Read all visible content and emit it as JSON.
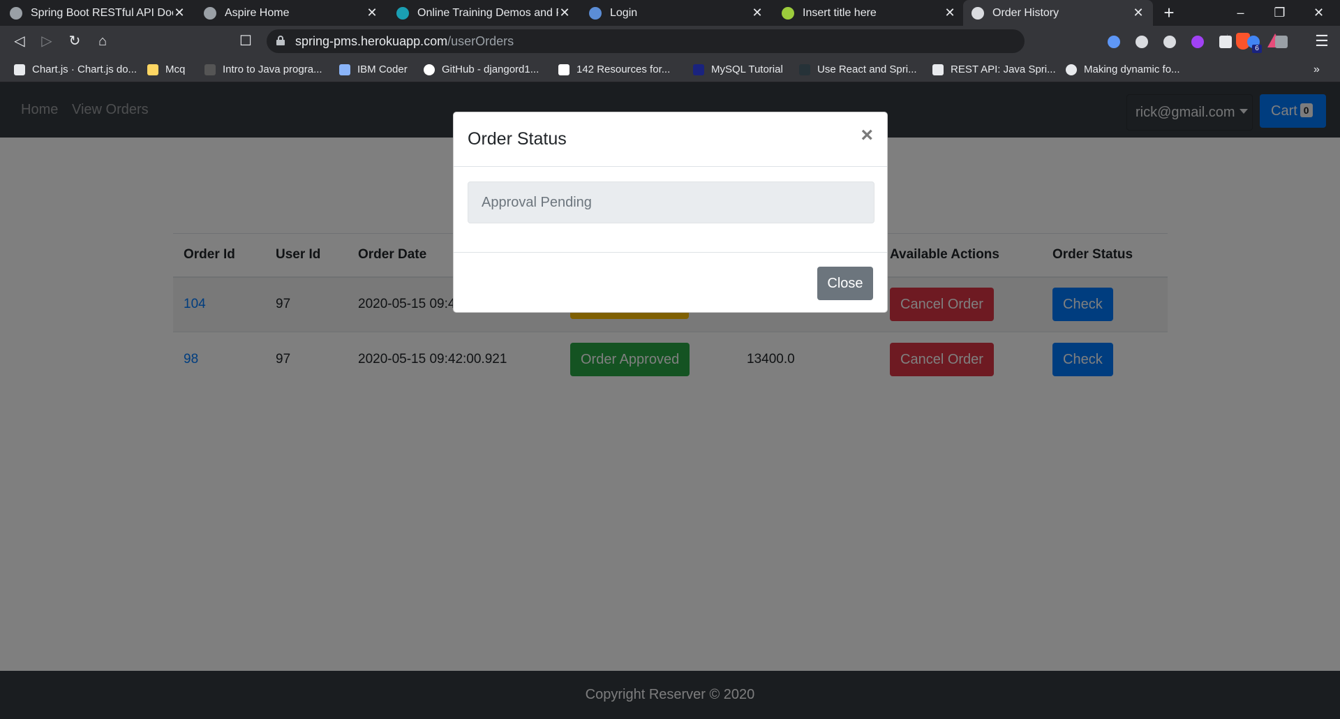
{
  "tabs": [
    {
      "title": "Spring Boot RESTful API Docum",
      "icon_color": "#9aa0a6"
    },
    {
      "title": "Aspire Home",
      "icon_color": "#9aa0a6"
    },
    {
      "title": "Online Training Demos and PP",
      "icon_color": "#1a9fb3"
    },
    {
      "title": "Login",
      "icon_color": "#5b8dd6"
    },
    {
      "title": "Insert title here",
      "icon_color": "#9ccc3c"
    },
    {
      "title": "Order History",
      "icon_color": "#dadce0"
    }
  ],
  "tab_close_glyph": "✕",
  "address_bar": {
    "host": "spring-pms.herokuapp.com",
    "path": "/userOrders"
  },
  "bookmarks": [
    {
      "label": "Chart.js · Chart.js do...",
      "icon_color": "#e8eaed"
    },
    {
      "label": "Mcq",
      "icon_color": "#fdd663"
    },
    {
      "label": "Intro to Java progra...",
      "icon_color": "#555555"
    },
    {
      "label": "IBM Coder",
      "icon_color": "#8ab4f8"
    },
    {
      "label": "GitHub - djangord1...",
      "icon_color": "#ffffff"
    },
    {
      "label": "142 Resources for...",
      "icon_color": "#ffffff"
    },
    {
      "label": "MySQL Tutorial",
      "icon_color": "#1a237e"
    },
    {
      "label": "Use React and Spri...",
      "icon_color": "#263238"
    },
    {
      "label": "REST API: Java Spri...",
      "icon_color": "#e8eaed"
    },
    {
      "label": "Making dynamic fo...",
      "icon_color": "#e8eaed"
    }
  ],
  "extension_badge": "6",
  "navbar": {
    "links": [
      "Home",
      "View Orders"
    ],
    "user_email": "rick@gmail.com",
    "cart_label": "Cart",
    "cart_count": "0"
  },
  "table": {
    "headers": [
      "Order Id",
      "User Id",
      "Order Date",
      "",
      "",
      "Available Actions",
      "Order Status"
    ],
    "rows": [
      {
        "order_id": "104",
        "user_id": "97",
        "order_date": "2020-05-15 09:4",
        "status_label": "",
        "amount": "",
        "action": "Cancel Order",
        "check": "Check"
      },
      {
        "order_id": "98",
        "user_id": "97",
        "order_date": "2020-05-15 09:42:00.921",
        "status_label": "Order Approved",
        "amount": "13400.0",
        "action": "Cancel Order",
        "check": "Check"
      }
    ]
  },
  "footer": {
    "text": "Copyright Reserver © 2020"
  },
  "modal": {
    "title": "Order Status",
    "close_glyph": "×",
    "status_value": "Approval Pending",
    "close_button": "Close"
  },
  "colors": {
    "primary": "#007bff",
    "success": "#28a745",
    "danger": "#dc3545",
    "warning": "#ffc107",
    "navbar": "#343a40"
  }
}
